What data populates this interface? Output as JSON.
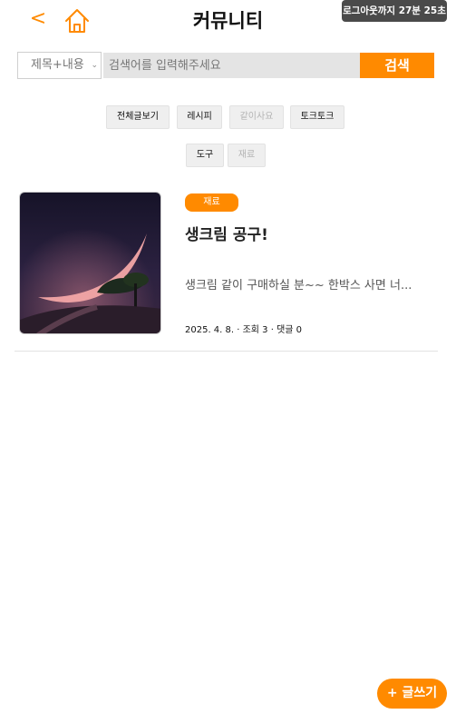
{
  "header": {
    "title": "커뮤니티",
    "back_label": "<",
    "session_timer": "로그아웃까지 27분 25초"
  },
  "search": {
    "select_value": "제목+내용",
    "placeholder": "검색어를 입력해주세요",
    "value": "",
    "button_label": "검색"
  },
  "categories": [
    {
      "label": "전체글보기",
      "active": true
    },
    {
      "label": "레시피",
      "active": true
    },
    {
      "label": "같이사요",
      "active": false
    },
    {
      "label": "토크토크",
      "active": true
    },
    {
      "label": "도구",
      "active": true
    },
    {
      "label": "재료",
      "active": false
    }
  ],
  "posts": [
    {
      "badge": "재료",
      "title": "생크림 공구!",
      "excerpt": "생크림 같이 구매하실 분~~ 한박스 사면 너...",
      "meta": "2025. 4. 8. · 조회 3 · 댓글 0",
      "thumbnail": "crescent-moon-tree-night-image"
    }
  ],
  "write_button_label": "+ 글쓰기",
  "colors": {
    "accent": "#ff8a00",
    "search_bg": "#e4e4e4",
    "timer_bg": "#4a4a4a",
    "chip_bg": "#efefef"
  }
}
